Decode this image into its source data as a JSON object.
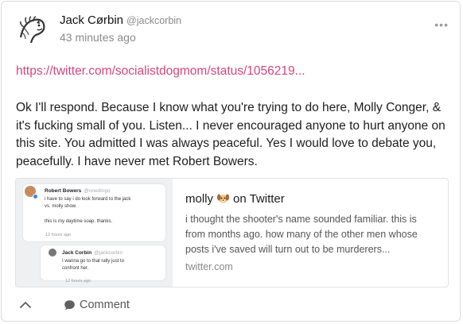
{
  "post": {
    "author_name": "Jack Cørbin",
    "author_handle": "@jackcorbin",
    "timestamp": "43 minutes ago",
    "link": "https://twitter.com/socialistdogmom/status/1056219...",
    "body": "Ok I'll respond. Because I know what you're trying to do here, Molly Conger, & it's fucking small of you. Listen... I never encouraged anyone to hurt anyone on this site. You admitted I was always peaceful. Yes I would love to debate you, peacefully. I have never met Robert Bowers."
  },
  "embed": {
    "title_name": "molly",
    "title_suffix": "on Twitter",
    "description": "i thought the shooter's name sounded familiar. this is from months ago. how many of the other men whose posts i've saved will turn out to be murderers...",
    "domain": "twitter.com",
    "thumbnail": {
      "card1": {
        "name": "Robert Bowers",
        "handle": "@onedingo",
        "line1": "i have to say i do look forward to the jack",
        "line2": "vs. molly show.",
        "line3": "this is my daytime soap. thanks.",
        "time": "12 hours ago"
      },
      "card2": {
        "name": "Jack Corbin",
        "handle": "@jackcorbin",
        "line1": "I wanna go to that rally just to",
        "line2": "confront her.",
        "time": "12 hours ago"
      }
    }
  },
  "footer": {
    "comment_label": "Comment"
  },
  "icons": {
    "more": "more-options-icon",
    "up": "chevron-up-icon",
    "comment": "comment-bubble-icon",
    "dog": "dog-emoji-icon"
  },
  "colors": {
    "link": "#d4467c",
    "muted": "#8a8a8a",
    "border": "#dcdcdc"
  }
}
